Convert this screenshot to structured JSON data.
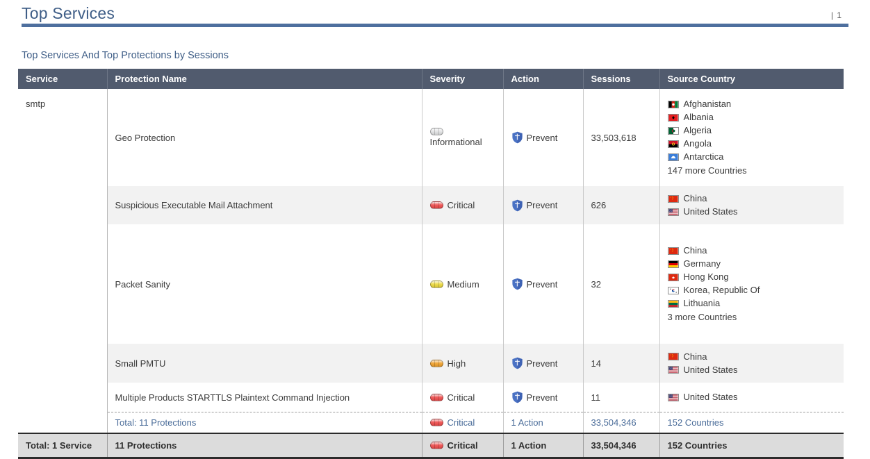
{
  "header": {
    "title": "Top Services",
    "page_number": "| 1"
  },
  "subtitle": "Top Services And Top Protections by Sessions",
  "table": {
    "columns": [
      "Service",
      "Protection Name",
      "Severity",
      "Action",
      "Sessions",
      "Source Country"
    ],
    "service": "smtp",
    "rows": [
      {
        "protection": "Geo Protection",
        "severity": "Informational",
        "severity_level": "informational",
        "action": "Prevent",
        "sessions": "33,503,618",
        "countries": [
          "Afghanistan",
          "Albania",
          "Algeria",
          "Angola",
          "Antarctica"
        ],
        "more_countries": "147 more Countries"
      },
      {
        "protection": "Suspicious Executable Mail Attachment",
        "severity": "Critical",
        "severity_level": "critical",
        "action": "Prevent",
        "sessions": "626",
        "countries": [
          "China",
          "United States"
        ],
        "more_countries": ""
      },
      {
        "protection": "Packet Sanity",
        "severity": "Medium",
        "severity_level": "medium",
        "action": "Prevent",
        "sessions": "32",
        "countries": [
          "China",
          "Germany",
          "Hong Kong",
          "Korea, Republic Of",
          "Lithuania"
        ],
        "more_countries": "3 more Countries"
      },
      {
        "protection": "Small PMTU",
        "severity": "High",
        "severity_level": "high",
        "action": "Prevent",
        "sessions": "14",
        "countries": [
          "China",
          "United States"
        ],
        "more_countries": ""
      },
      {
        "protection": "Multiple Products STARTTLS Plaintext Command Injection",
        "severity": "Critical",
        "severity_level": "critical",
        "action": "Prevent",
        "sessions": "11",
        "countries": [
          "United States"
        ],
        "more_countries": ""
      }
    ],
    "subtotal": {
      "protection": "Total: 11 Protections",
      "severity": "Critical",
      "action": "1 Action",
      "sessions": "33,504,346",
      "countries": "152 Countries"
    },
    "grand_total": {
      "service": "Total: 1 Service",
      "protection": "11 Protections",
      "severity": "Critical",
      "action": "1 Action",
      "sessions": "33,504,346",
      "countries": "152 Countries"
    }
  },
  "colors": {
    "title": "#3f5e87",
    "rule": "#4e6f9e",
    "table_header_bg": "#515b6e",
    "stripe": "#f2f2f2",
    "subtotal_text": "#4a6c99",
    "severity_critical": "#ef4b4b",
    "severity_high": "#f0a029",
    "severity_medium": "#ecd93c",
    "severity_informational": "#e2e3e4",
    "action_shield": "#4a72c4"
  }
}
